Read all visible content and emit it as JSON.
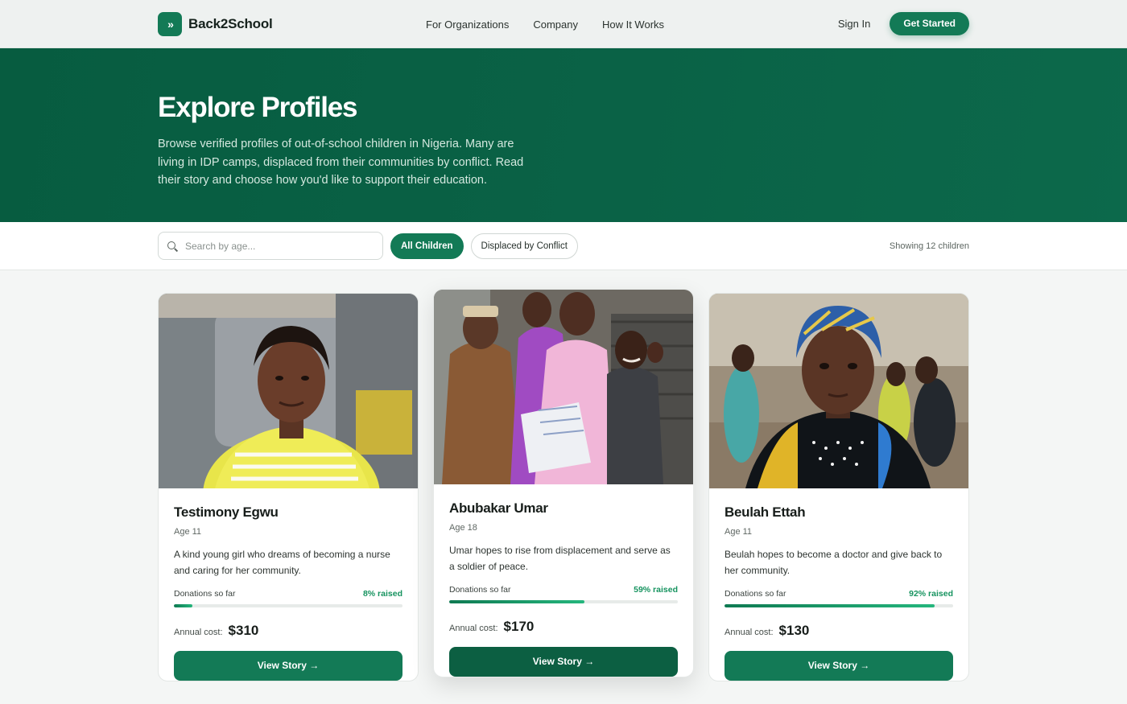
{
  "nav": {
    "brand": "Back2School",
    "logo_icon": "double-chevron-right-icon",
    "links": [
      "For Organizations",
      "Company",
      "How It Works"
    ],
    "sign_in": "Sign In",
    "get_started": "Get Started"
  },
  "hero": {
    "title": "Explore Profiles",
    "description": "Browse verified profiles of out-of-school children in Nigeria. Many are living in IDP camps, displaced from their communities by conflict. Read their story and choose how you'd like to support their education."
  },
  "filters": {
    "search_placeholder": "Search by age...",
    "chips": [
      "All Children",
      "Displaced by Conflict"
    ],
    "active_chip": "All Children",
    "showing": "Showing 12 children"
  },
  "cards": [
    {
      "name": "Testimony Egwu",
      "age": "Age 11",
      "description": "A kind young girl who dreams of becoming a nurse and caring for her community.",
      "donations_label": "Donations so far",
      "raised": "8% raised",
      "progress": 0.08,
      "cost_label": "Annual cost:",
      "cost": "$310",
      "button": "View Story →"
    },
    {
      "name": "Abubakar Umar",
      "age": "Age 18",
      "description": "Umar hopes to rise from displacement and serve as a soldier of peace.",
      "donations_label": "Donations so far",
      "raised": "59% raised",
      "progress": 0.59,
      "cost_label": "Annual cost:",
      "cost": "$170",
      "button": "View Story →"
    },
    {
      "name": "Beulah Ettah",
      "age": "Age 11",
      "description": "Beulah hopes to become a doctor and give back to her community.",
      "donations_label": "Donations so far",
      "raised": "92% raised",
      "progress": 0.92,
      "cost_label": "Annual cost:",
      "cost": "$130",
      "button": "View Story →"
    }
  ],
  "colors": {
    "brand_green": "#137a56",
    "hero_bg": "#075c40",
    "progress_green": "#16935f"
  }
}
